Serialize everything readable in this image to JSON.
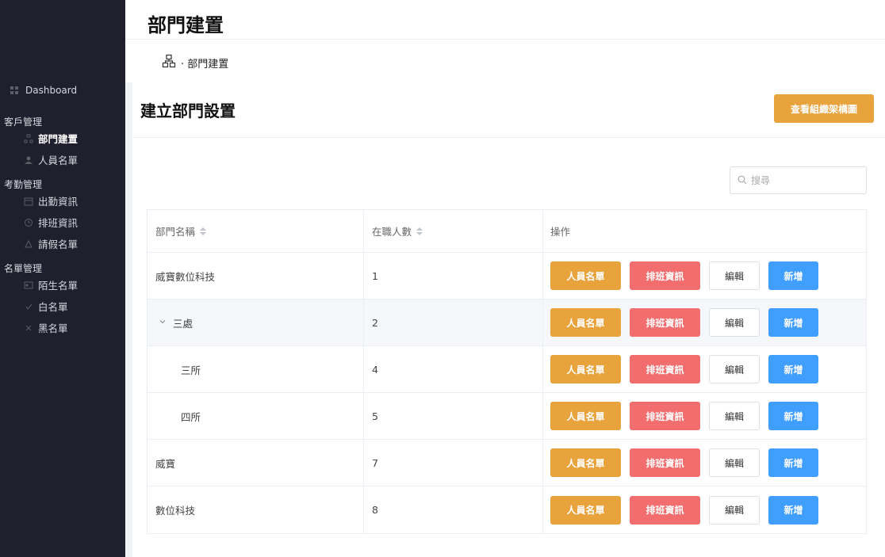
{
  "sidebar": {
    "dashboard": "Dashboard",
    "groups": [
      {
        "title": "客戶管理",
        "items": [
          {
            "label": "部門建置",
            "icon": "org-icon",
            "active": true
          },
          {
            "label": "人員名單",
            "icon": "user-icon"
          }
        ]
      },
      {
        "title": "考勤管理",
        "items": [
          {
            "label": "出勤資訊",
            "icon": "calendar-icon"
          },
          {
            "label": "排班資訊",
            "icon": "clock-icon"
          },
          {
            "label": "請假名單",
            "icon": "leave-icon"
          }
        ]
      },
      {
        "title": "名單管理",
        "items": [
          {
            "label": "陌生名單",
            "icon": "id-card-icon"
          },
          {
            "label": "白名單",
            "icon": "whitelist-icon"
          },
          {
            "label": "黑名單",
            "icon": "blacklist-icon"
          }
        ]
      }
    ]
  },
  "header": {
    "title": "部門建置",
    "breadcrumb": "· 部門建置"
  },
  "card": {
    "title": "建立部門設置",
    "org_chart_button": "查看組織架構圖",
    "search_placeholder": "搜尋"
  },
  "table": {
    "headers": {
      "name": "部門名稱",
      "count": "在職人數",
      "actions": "操作"
    },
    "action_labels": {
      "people": "人員名單",
      "shift": "排班資訊",
      "edit": "編輯",
      "add": "新增"
    },
    "rows": [
      {
        "name": "威寶數位科技",
        "count": "1",
        "level": 0
      },
      {
        "name": "三處",
        "count": "2",
        "level": 1,
        "expanded": true
      },
      {
        "name": "三所",
        "count": "4",
        "level": 2
      },
      {
        "name": "四所",
        "count": "5",
        "level": 2
      },
      {
        "name": "威寶",
        "count": "7",
        "level": 0
      },
      {
        "name": "數位科技",
        "count": "8",
        "level": 0
      }
    ]
  },
  "colors": {
    "sidebar_bg": "#1f1f2d",
    "orange": "#e8a33d",
    "red": "#f26d6d",
    "blue": "#409eff"
  }
}
